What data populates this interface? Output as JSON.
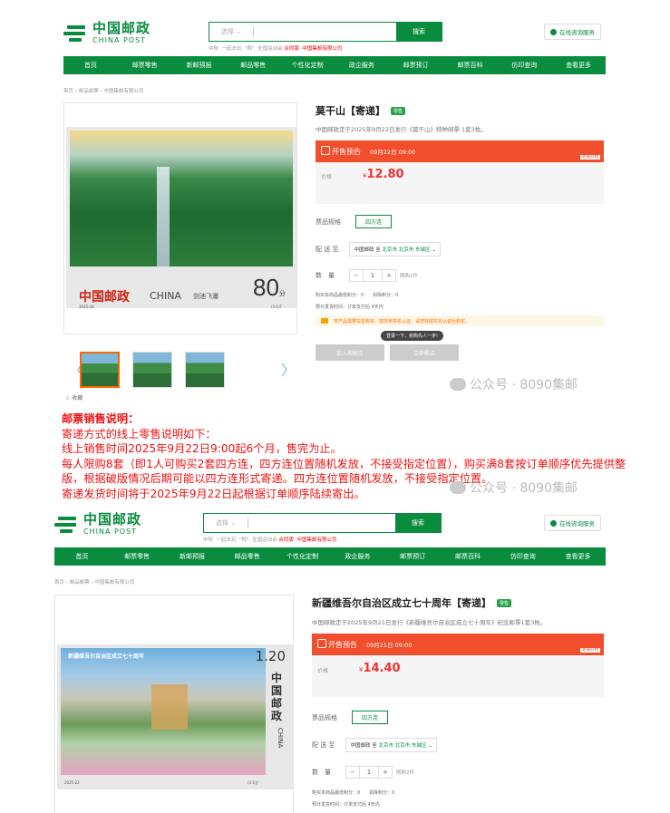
{
  "header": {
    "logo_cn": "中国邮政",
    "logo_en": "CHINA POST",
    "search_select": "选择",
    "search_button": "搜索",
    "hot_words": [
      "中秋",
      "一起去玩",
      "\"鸭\"",
      "全国运动会",
      "合同版",
      "中国集邮有限公司"
    ],
    "service_button": "在线咨询服务"
  },
  "nav": [
    "首页",
    "邮票零售",
    "新邮预报",
    "邮品零售",
    "个性化定制",
    "政企服务",
    "邮票预订",
    "邮票百科",
    "仿印查询",
    "查看更多"
  ],
  "breadcrumb": "首页 › 邮品邮票 › 中国集邮有限公司",
  "product1": {
    "title": "莫干山【寄递】",
    "tag": "零售",
    "subtitle": "中国邮政定于2025年9月22日发行《莫干山》特种邮票 1套3枚。",
    "presale_label": "开售预告",
    "presale_time": "09月22日 09:00",
    "countdown_label": "距离开始",
    "countdown": [
      "2",
      "天",
      "12",
      "04",
      "45"
    ],
    "price_label": "价格",
    "price_currency": "¥",
    "price": "12.80",
    "spec_label": "票品规格",
    "spec_value": "四方连",
    "ship_label": "配 送 至",
    "ship_from": "中国邮政 至",
    "ship_to": "北京市 北京市 东城区",
    "qty_label": "数　量",
    "qty_value": "1",
    "qty_limit": "限购2件",
    "points": "购买本商品最低积分：0　　扣除积分：0",
    "delivery": "预计发货时间：订单支付后 4天内",
    "notice": "本产品需要实名购买，如您未实名认证，请您完成实名认证后购买。",
    "tip": "登录一下，抢购先人一步!",
    "btn_cart": "加入购物车",
    "btn_buy": "立即购买",
    "fav": "收藏",
    "stamp_cn": "中国邮政",
    "stamp_en": "CHINA",
    "stamp_name": "剑池飞瀑",
    "stamp_value": "80",
    "stamp_unit": "分",
    "stamp_code": "2025-18",
    "stamp_idx": "(3-1)T"
  },
  "watermark": "公众号 · 8090集邮",
  "description": {
    "heading": "邮票销售说明：",
    "lines": [
      "寄递方式的线上零售说明如下：",
      "线上销售时间2025年9月22日9:00起6个月，售完为止。",
      "每人限购8套（即1人可购买2套四方连，四方连位置随机发放，不接受指定位置），购买满8套按订单顺序优先提供整版，根据破版情况后期可能以四方连形式寄递。四方连位置随机发放，不接受指定位置。",
      "寄递发货时间将于2025年9月22日起根据订单顺序陆续寄出。"
    ]
  },
  "product2": {
    "title": "新疆维吾尔自治区成立七十周年【寄递】",
    "tag": "零售",
    "subtitle": "中国邮政定于2025年9月21日发行《新疆维吾尔自治区成立七十周年》纪念邮票1套3枚。",
    "presale_label": "开售预告",
    "presale_time": "09月21日 09:00",
    "countdown_label": "距离开始",
    "countdown": [
      "1",
      "天",
      "11",
      "39",
      "38"
    ],
    "price_label": "价格",
    "price_currency": "¥",
    "price": "14.40",
    "spec_label": "票品规格",
    "spec_value": "四方连",
    "ship_label": "配 送 至",
    "ship_from": "中国邮政 至",
    "ship_to": "北京市 北京市 东城区",
    "qty_label": "数　量",
    "qty_value": "1",
    "qty_limit": "限购2件",
    "points": "购买本商品最低积分：0　　扣除积分：0",
    "delivery": "预计发货时间：订单支付后 4天内",
    "stamp_banner": "新疆维吾尔自治区成立七十周年",
    "stamp_value": "1.20",
    "stamp_cn": "中国邮政",
    "stamp_en": "CHINA",
    "stamp_code": "2025-22",
    "stamp_idx": "(3-1)J"
  }
}
